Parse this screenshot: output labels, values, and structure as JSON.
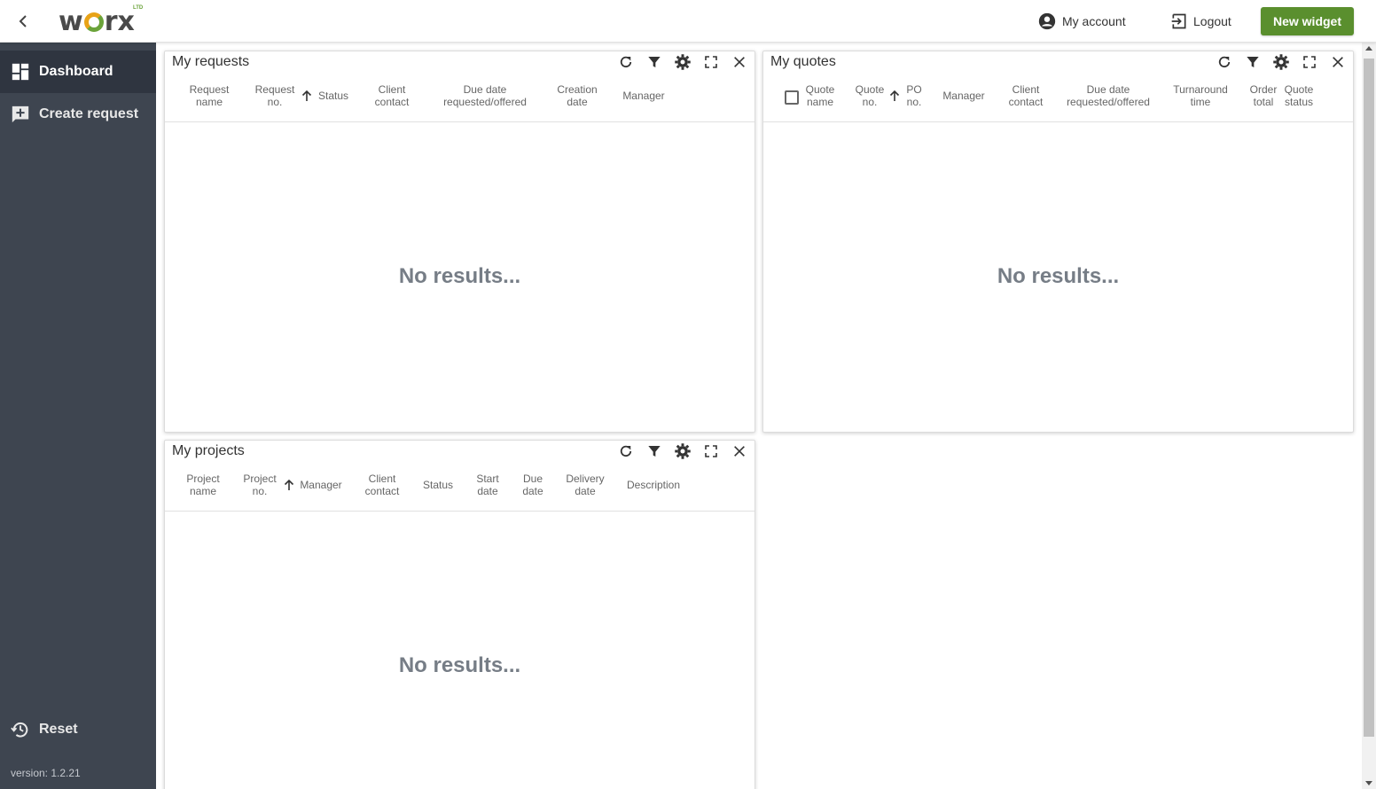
{
  "header": {
    "logo_text_left": "w",
    "logo_text_right": "rx",
    "logo_ltd": "LTD",
    "my_account": "My account",
    "logout": "Logout",
    "new_widget": "New widget"
  },
  "sidebar": {
    "items": [
      {
        "label": "Dashboard",
        "icon": "dashboard-icon",
        "active": true
      },
      {
        "label": "Create request",
        "icon": "add-comment-icon",
        "active": false
      }
    ],
    "reset": "Reset",
    "version": "version: 1.2.21"
  },
  "widgets": {
    "requests": {
      "title": "My requests",
      "columns": [
        "Request\nname",
        "Request\nno.",
        "Status",
        "Client\ncontact",
        "Due date\nrequested/offered",
        "Creation\ndate",
        "Manager"
      ],
      "empty": "No results..."
    },
    "quotes": {
      "title": "My quotes",
      "columns": [
        "Quote\nname",
        "Quote\nno.",
        "PO\nno.",
        "Manager",
        "Client\ncontact",
        "Due date\nrequested/offered",
        "Turnaround\ntime",
        "Order\ntotal",
        "Quote\nstatus"
      ],
      "empty": "No results..."
    },
    "projects": {
      "title": "My projects",
      "columns": [
        "Project\nname",
        "Project\nno.",
        "Manager",
        "Client\ncontact",
        "Status",
        "Start\ndate",
        "Due\ndate",
        "Delivery\ndate",
        "Description"
      ],
      "empty": "No results..."
    }
  },
  "colors": {
    "accent_green": "#5a8f2e",
    "sidebar_bg": "#3e4550",
    "sidebar_active": "#2f3540"
  }
}
